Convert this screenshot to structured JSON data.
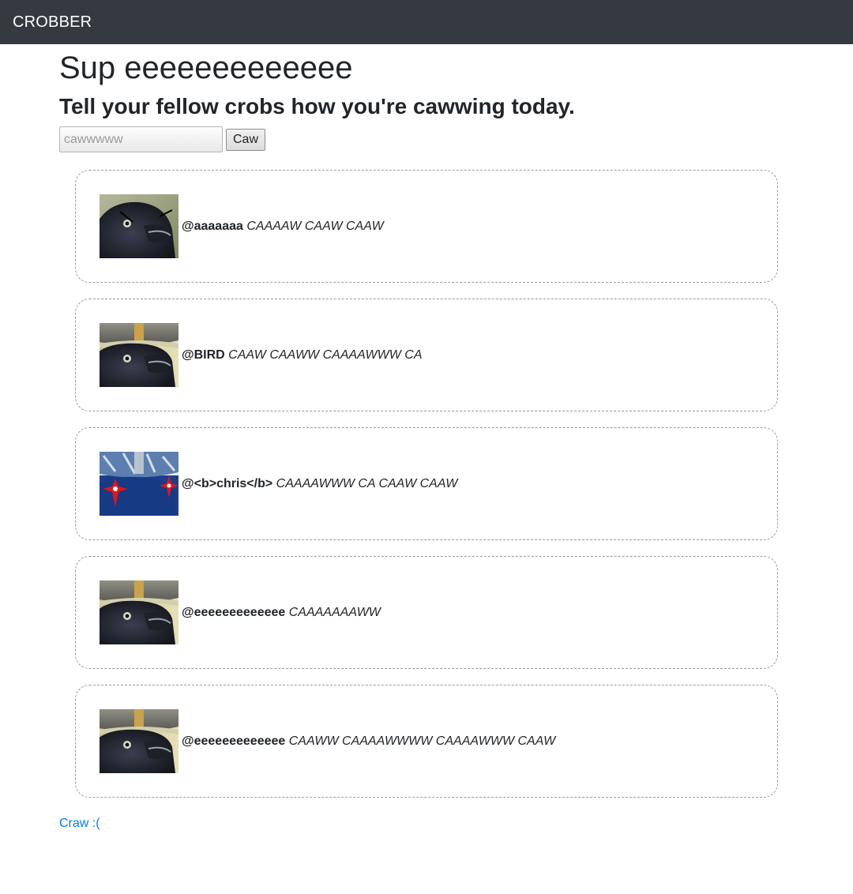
{
  "navbar": {
    "brand": "CROBBER"
  },
  "greeting": "Sup eeeeeeeeeeeee",
  "prompt": "Tell your fellow crobs how you're cawwing today.",
  "compose": {
    "placeholder": "cawwwww",
    "button_label": "Caw"
  },
  "caws": [
    {
      "handle": "@aaaaaaa",
      "message": "CAAAAW CAAW CAAW",
      "avatar": "angry-crow-avatar"
    },
    {
      "handle": "@BIRD",
      "message": "CAAW CAAWW CAAAAWWW CA",
      "avatar": "viking-crow-avatar"
    },
    {
      "handle": "@<b>chris</b>",
      "message": "CAAAAWWW CA CAAW CAAW",
      "avatar": "deepfried-crow-avatar"
    },
    {
      "handle": "@eeeeeeeeeeeee",
      "message": "CAAAAAAAWW",
      "avatar": "viking-crow-avatar"
    },
    {
      "handle": "@eeeeeeeeeeeee",
      "message": "CAAWW CAAAAWWWW CAAAAWWW CAAW",
      "avatar": "viking-crow-avatar"
    }
  ],
  "logout_link": "Craw :("
}
